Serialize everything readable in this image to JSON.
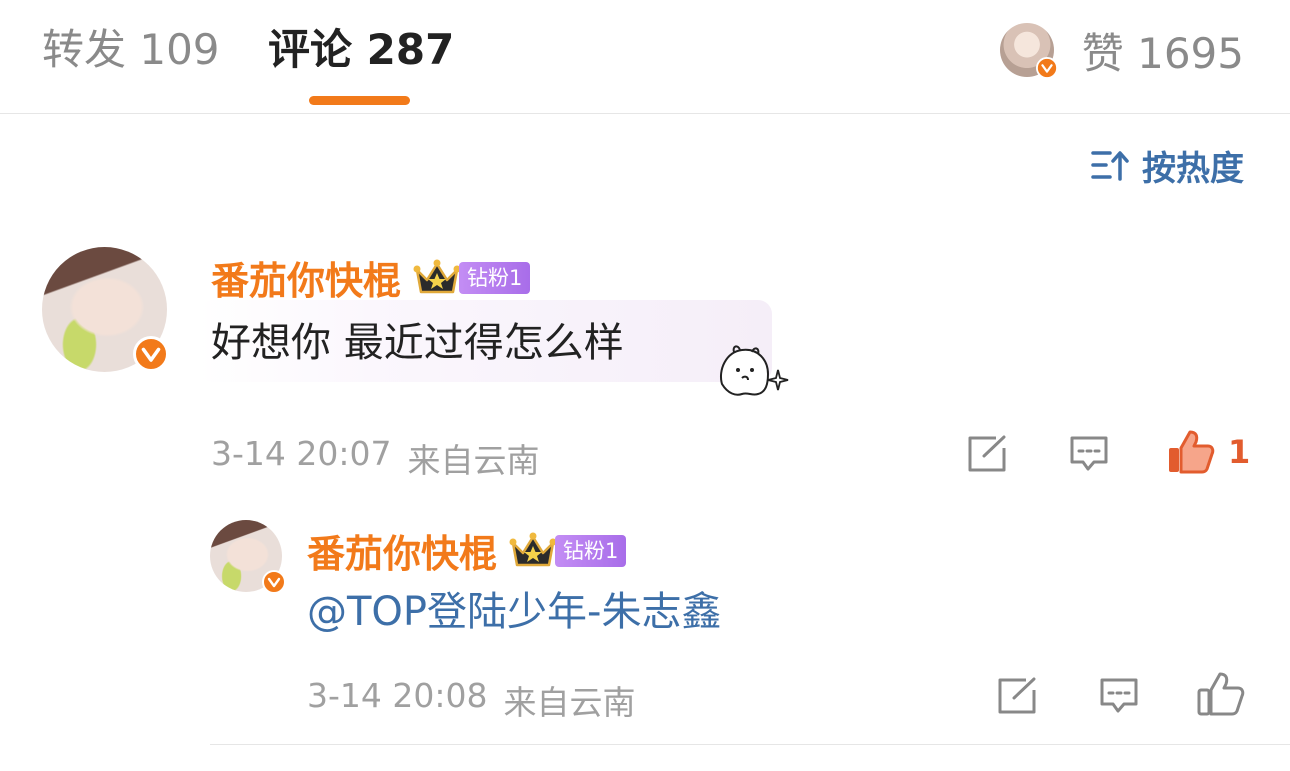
{
  "tabs": {
    "repost": "转发 109",
    "comments": "评论 287",
    "likes": "赞 1695"
  },
  "sort": {
    "label": "按热度",
    "icon": "sort-hot-icon"
  },
  "colors": {
    "accent": "#f27a1a",
    "link": "#3d6fa8",
    "like_active": "#e25c2e",
    "badge": "#b77cee"
  },
  "comment": {
    "username": "番茄你快棍",
    "fan_badge": "钻粉1",
    "text": "好想你 最近过得怎么样",
    "time": "3-14 20:07",
    "location": "来自云南",
    "like_count": "1"
  },
  "reply": {
    "username": "番茄你快棍",
    "fan_badge": "钻粉1",
    "text": "@TOP登陆少年-朱志鑫",
    "time": "3-14 20:08",
    "location": "来自云南"
  }
}
